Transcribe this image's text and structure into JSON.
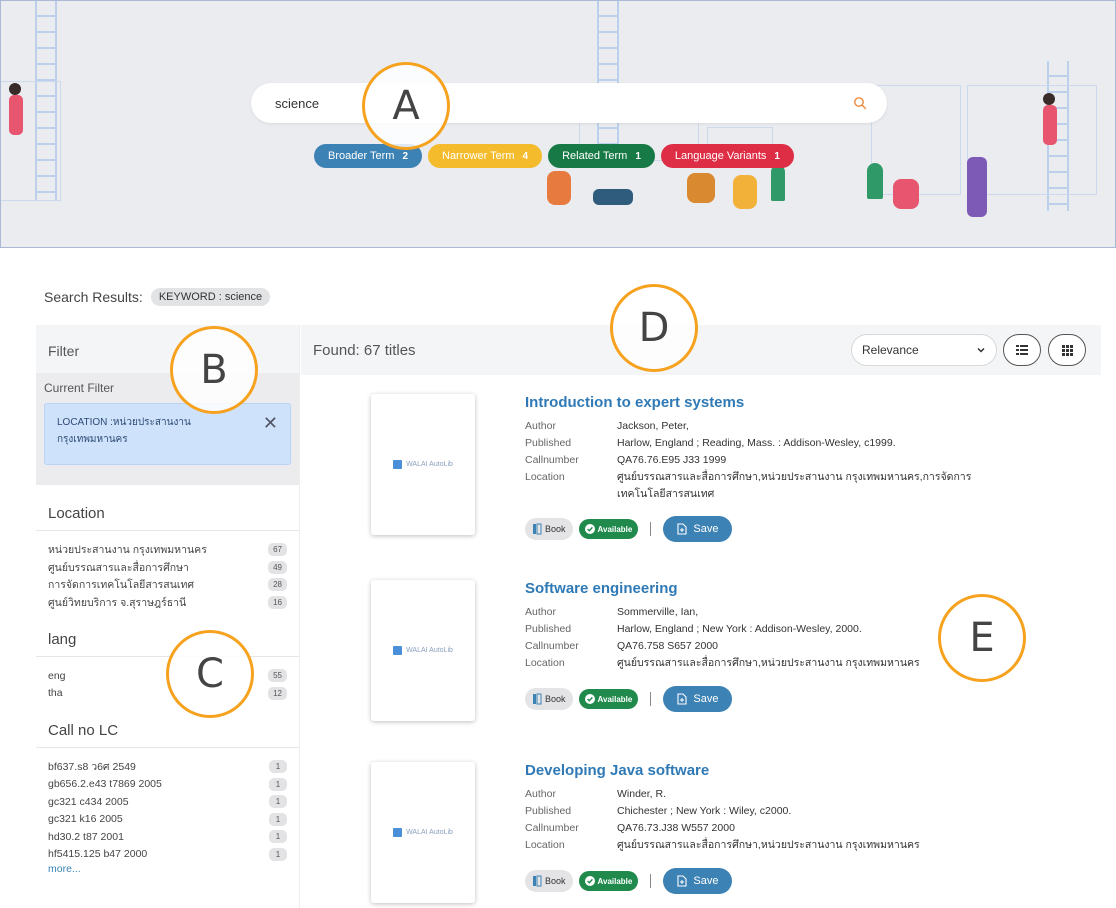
{
  "search": {
    "value": "science"
  },
  "terms": [
    {
      "label": "Broader Term",
      "count": "2",
      "color": "#3c82b4"
    },
    {
      "label": "Narrower Term",
      "count": "4",
      "color": "#f4bc2d"
    },
    {
      "label": "Related Term",
      "count": "1",
      "color": "#177a46"
    },
    {
      "label": "Language Variants",
      "count": "1",
      "color": "#dd2e46"
    }
  ],
  "markers": {
    "a": "A",
    "b": "B",
    "c": "C",
    "d": "D",
    "e": "E"
  },
  "results_header": {
    "label": "Search Results:",
    "keyword": "KEYWORD : science"
  },
  "filter": {
    "title": "Filter",
    "current_label": "Current Filter",
    "current_value_line1": "LOCATION :หน่วยประสานงาน",
    "current_value_line2": "กรุงเทพมหานคร",
    "sections": [
      {
        "title": "Location",
        "items": [
          {
            "label": "หน่วยประสานงาน กรุงเทพมหานคร",
            "count": "67"
          },
          {
            "label": "ศูนย์บรรณสารและสื่อการศึกษา",
            "count": "49"
          },
          {
            "label": "การจัดการเทคโนโลยีสารสนเทศ",
            "count": "28"
          },
          {
            "label": "ศูนย์วิทยบริการ จ.สุราษฎร์ธานี",
            "count": "16"
          }
        ]
      },
      {
        "title": "lang",
        "items": [
          {
            "label": "eng",
            "count": "55"
          },
          {
            "label": "tha",
            "count": "12"
          }
        ]
      },
      {
        "title": "Call no LC",
        "items": [
          {
            "label": "bf637.s8 ว6ศ 2549",
            "count": "1"
          },
          {
            "label": "gb656.2.e43 t7869 2005",
            "count": "1"
          },
          {
            "label": "gc321 c434 2005",
            "count": "1"
          },
          {
            "label": "gc321 k16 2005",
            "count": "1"
          },
          {
            "label": "hd30.2 t87 2001",
            "count": "1"
          },
          {
            "label": "hf5415.125 b47 2000",
            "count": "1"
          }
        ],
        "more": "more..."
      }
    ]
  },
  "results": {
    "found": "Found: 67 titles",
    "sort": "Relevance",
    "cover_text": "WALAI AutoLib",
    "labels": {
      "author": "Author",
      "published": "Published",
      "callnumber": "Callnumber",
      "location": "Location"
    },
    "book_label": "Book",
    "available_label": "Available",
    "save_label": "Save",
    "items": [
      {
        "title": "Introduction to expert systems",
        "author": "Jackson, Peter,",
        "published": "Harlow, England ; Reading, Mass. : Addison-Wesley, c1999.",
        "callnumber": "QA76.76.E95 J33 1999",
        "location": "ศูนย์บรรณสารและสื่อการศึกษา,หน่วยประสานงาน กรุงเทพมหานคร,การจัดการเทคโนโลยีสารสนเทศ"
      },
      {
        "title": "Software engineering",
        "author": "Sommerville, Ian,",
        "published": "Harlow, England ; New York : Addison-Wesley, 2000.",
        "callnumber": "QA76.758 S657 2000",
        "location": "ศูนย์บรรณสารและสื่อการศึกษา,หน่วยประสานงาน กรุงเทพมหานคร"
      },
      {
        "title": "Developing Java software",
        "author": "Winder, R.",
        "published": "Chichester ; New York : Wiley, c2000.",
        "callnumber": "QA76.73.J38 W557 2000",
        "location": "ศูนย์บรรณสารและสื่อการศึกษา,หน่วยประสานงาน กรุงเทพมหานคร"
      }
    ]
  }
}
